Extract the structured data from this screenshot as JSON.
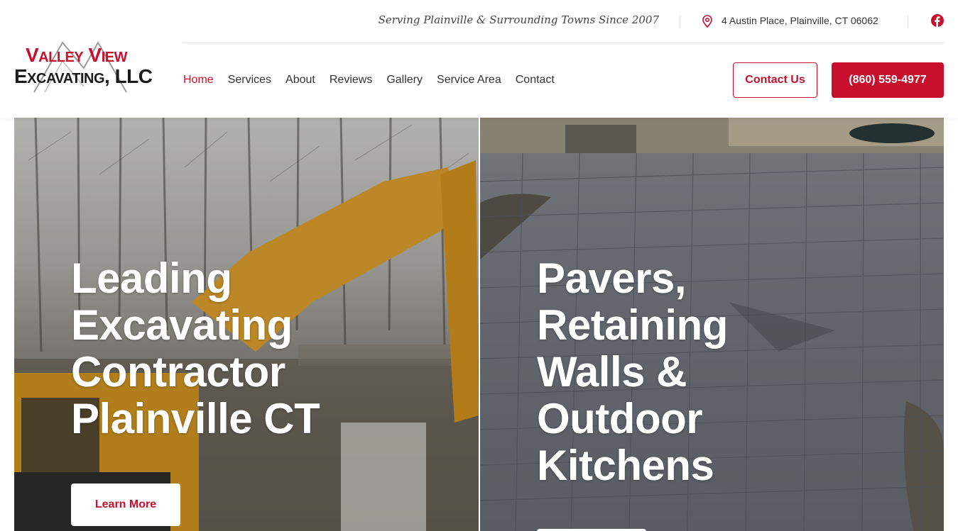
{
  "header": {
    "logo": {
      "line1": "Valley View",
      "line2": "Excavating, LLC"
    },
    "tagline": "Serving Plainville & Surrounding Towns Since 2007",
    "address": "4 Austin Place, Plainville, CT 06062",
    "nav": [
      {
        "label": "Home",
        "active": true
      },
      {
        "label": "Services"
      },
      {
        "label": "About"
      },
      {
        "label": "Reviews"
      },
      {
        "label": "Gallery"
      },
      {
        "label": "Service Area"
      },
      {
        "label": "Contact"
      }
    ],
    "contact_button": "Contact Us",
    "phone_button": "(860) 559-4977"
  },
  "hero": {
    "left": {
      "title_lines": [
        "Leading",
        "Excavating",
        "Contractor",
        "Plainville CT"
      ],
      "button": "Learn More"
    },
    "right": {
      "title_lines": [
        "Pavers,",
        "Retaining",
        "Walls &",
        "Outdoor",
        "Kitchens"
      ]
    }
  },
  "colors": {
    "accent": "#c8102e",
    "text": "#333333"
  },
  "icons": {
    "address": "map-pin-icon",
    "social": "facebook-icon"
  }
}
